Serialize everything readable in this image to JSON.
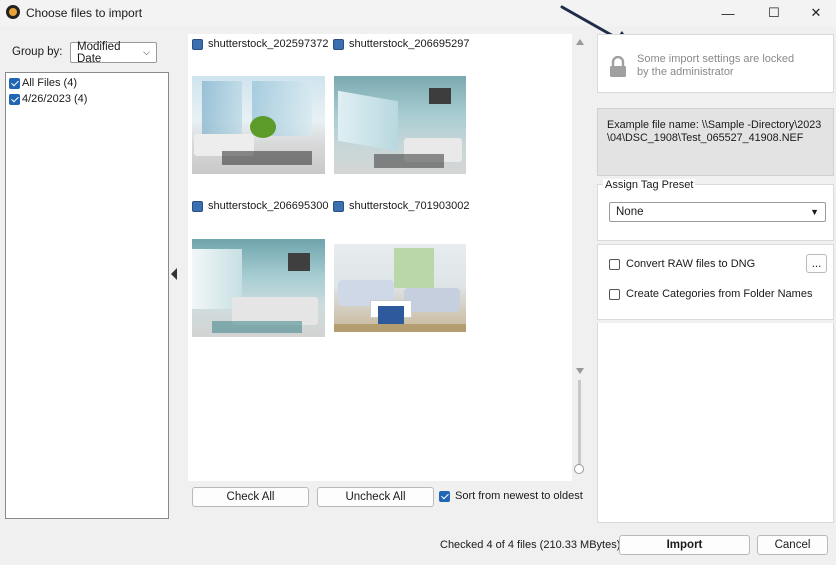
{
  "window": {
    "title": "Choose files to import",
    "controls": {
      "minimize": "—",
      "maximize": "☐",
      "close": "✕"
    }
  },
  "left": {
    "group_by_label": "Group by:",
    "group_by_value": "Modified Date",
    "tree": [
      {
        "label": "All Files (4)",
        "checked": true
      },
      {
        "label": "4/26/2023 (4)",
        "checked": true
      }
    ]
  },
  "gallery": {
    "files": [
      {
        "name": "shutterstock_202597372"
      },
      {
        "name": "shutterstock_206695297"
      },
      {
        "name": "shutterstock_206695300"
      },
      {
        "name": "shutterstock_701903002"
      }
    ],
    "check_all": "Check All",
    "uncheck_all": "Uncheck All",
    "sort_label": "Sort from newest to oldest",
    "sort_checked": true
  },
  "right": {
    "locked_line1": "Some import settings are locked",
    "locked_line2": "by the administrator",
    "example_filename": "Example file name: \\\\Sample -Directory\\2023\\04\\DSC_1908\\Test_065527_41908.NEF",
    "tag_preset_label": "Assign Tag Preset",
    "tag_preset_value": "None",
    "convert_raw_label": "Convert RAW files to DNG",
    "convert_raw_button": "...",
    "create_categories_label": "Create Categories from Folder Names"
  },
  "footer": {
    "status": "Checked 4 of 4 files (210.33 MBytes)",
    "import": "Import",
    "cancel": "Cancel"
  },
  "colors": {
    "accent": "#1f66b5",
    "annotation_arrow": "#1f2d4a"
  }
}
